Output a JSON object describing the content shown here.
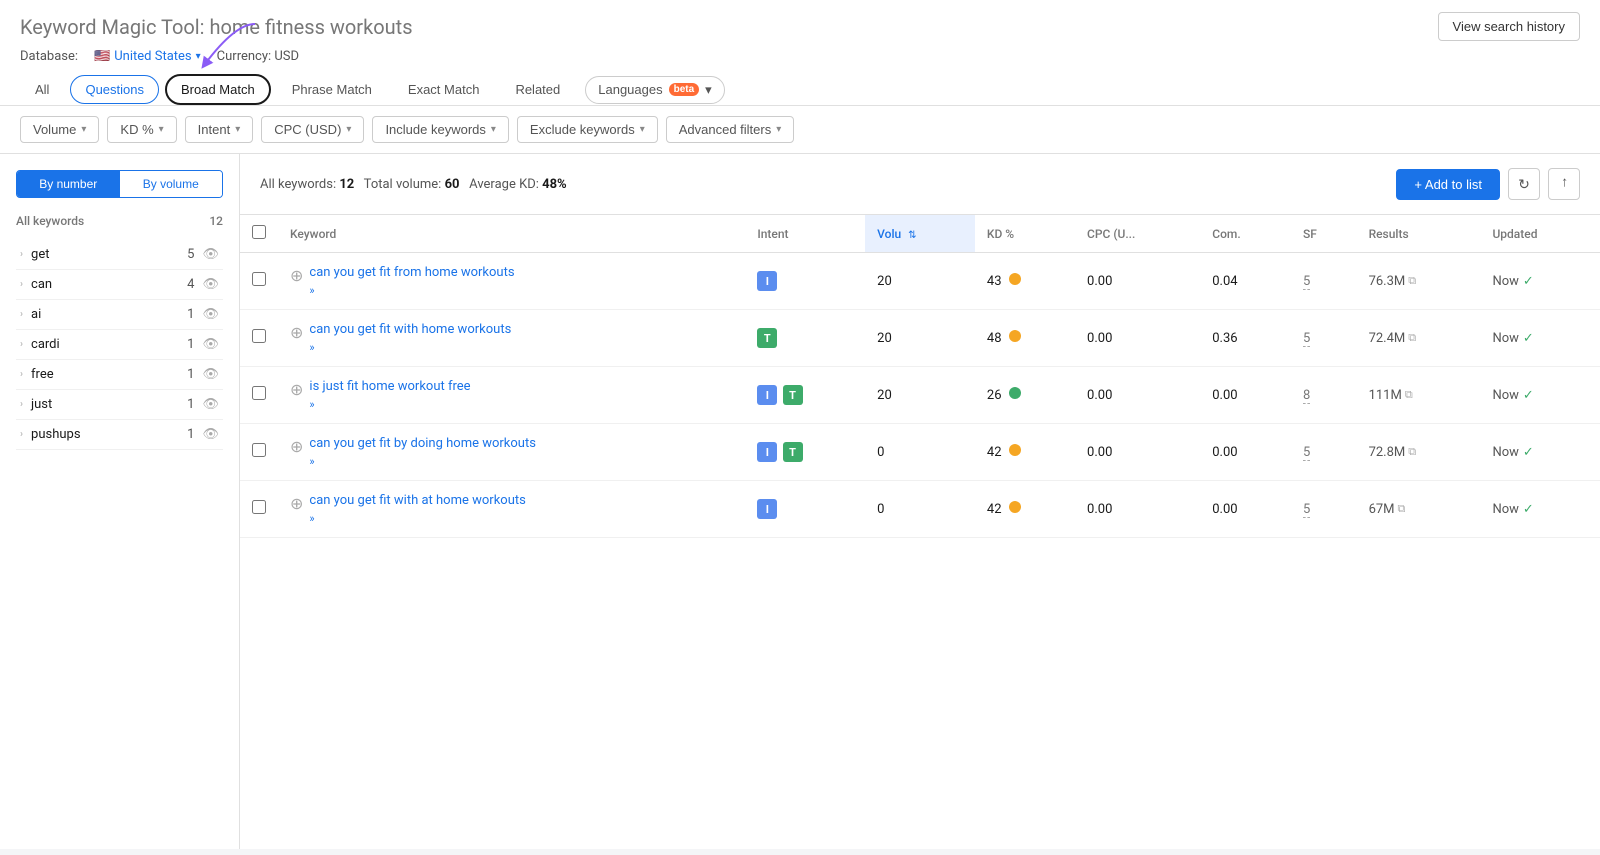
{
  "header": {
    "title_prefix": "Keyword Magic Tool:",
    "title_query": "home fitness workouts",
    "view_history_label": "View search history"
  },
  "database": {
    "label": "Database:",
    "country": "United States",
    "currency_label": "Currency: USD"
  },
  "tabs": [
    {
      "id": "all",
      "label": "All",
      "active": false
    },
    {
      "id": "questions",
      "label": "Questions",
      "active": true
    },
    {
      "id": "broad-match",
      "label": "Broad Match",
      "selected": true
    },
    {
      "id": "phrase-match",
      "label": "Phrase Match"
    },
    {
      "id": "exact-match",
      "label": "Exact Match"
    },
    {
      "id": "related",
      "label": "Related"
    },
    {
      "id": "languages",
      "label": "Languages",
      "has_beta": true
    }
  ],
  "filters": [
    {
      "id": "volume",
      "label": "Volume"
    },
    {
      "id": "kd",
      "label": "KD %"
    },
    {
      "id": "intent",
      "label": "Intent"
    },
    {
      "id": "cpc",
      "label": "CPC (USD)"
    },
    {
      "id": "include",
      "label": "Include keywords"
    },
    {
      "id": "exclude",
      "label": "Exclude keywords"
    },
    {
      "id": "advanced",
      "label": "Advanced filters"
    }
  ],
  "sidebar": {
    "toggle": [
      "By number",
      "By volume"
    ],
    "active_toggle": 0,
    "all_keywords_label": "All keywords",
    "all_keywords_count": 12,
    "items": [
      {
        "label": "get",
        "count": 5
      },
      {
        "label": "can",
        "count": 4
      },
      {
        "label": "ai",
        "count": 1
      },
      {
        "label": "cardi",
        "count": 1
      },
      {
        "label": "free",
        "count": 1
      },
      {
        "label": "just",
        "count": 1
      },
      {
        "label": "pushups",
        "count": 1
      }
    ]
  },
  "table": {
    "stats": {
      "all_keywords_label": "All keywords:",
      "all_keywords_count": "12",
      "total_volume_label": "Total volume:",
      "total_volume": "60",
      "avg_kd_label": "Average KD:",
      "avg_kd": "48%"
    },
    "add_to_list_label": "+ Add to list",
    "columns": [
      "Keyword",
      "Intent",
      "Volume",
      "KD %",
      "CPC (U...",
      "Com.",
      "SF",
      "Results",
      "Updated"
    ],
    "rows": [
      {
        "keyword": "can you get fit from home workouts",
        "intents": [
          "I"
        ],
        "volume": "20",
        "kd": "43",
        "kd_color": "orange",
        "cpc": "0.00",
        "com": "0.04",
        "sf": "5",
        "results": "76.3M",
        "updated": "Now"
      },
      {
        "keyword": "can you get fit with home workouts",
        "intents": [
          "T"
        ],
        "volume": "20",
        "kd": "48",
        "kd_color": "orange",
        "cpc": "0.00",
        "com": "0.36",
        "sf": "5",
        "results": "72.4M",
        "updated": "Now"
      },
      {
        "keyword": "is just fit home workout free",
        "intents": [
          "I",
          "T"
        ],
        "volume": "20",
        "kd": "26",
        "kd_color": "green",
        "cpc": "0.00",
        "com": "0.00",
        "sf": "8",
        "results": "111M",
        "updated": "Now"
      },
      {
        "keyword": "can you get fit by doing home workouts",
        "intents": [
          "I",
          "T"
        ],
        "volume": "0",
        "kd": "42",
        "kd_color": "orange",
        "cpc": "0.00",
        "com": "0.00",
        "sf": "5",
        "results": "72.8M",
        "updated": "Now"
      },
      {
        "keyword": "can you get fit with at home workouts",
        "intents": [
          "I"
        ],
        "volume": "0",
        "kd": "42",
        "kd_color": "orange",
        "cpc": "0.00",
        "com": "0.00",
        "sf": "5",
        "results": "67M",
        "updated": "Now"
      }
    ]
  },
  "icons": {
    "chevron_down": "▾",
    "chevron_right": "›",
    "eye": "👁",
    "refresh": "↻",
    "export": "↑",
    "check": "✓",
    "plus_circle": "⊕",
    "search_icon": "🔍"
  }
}
